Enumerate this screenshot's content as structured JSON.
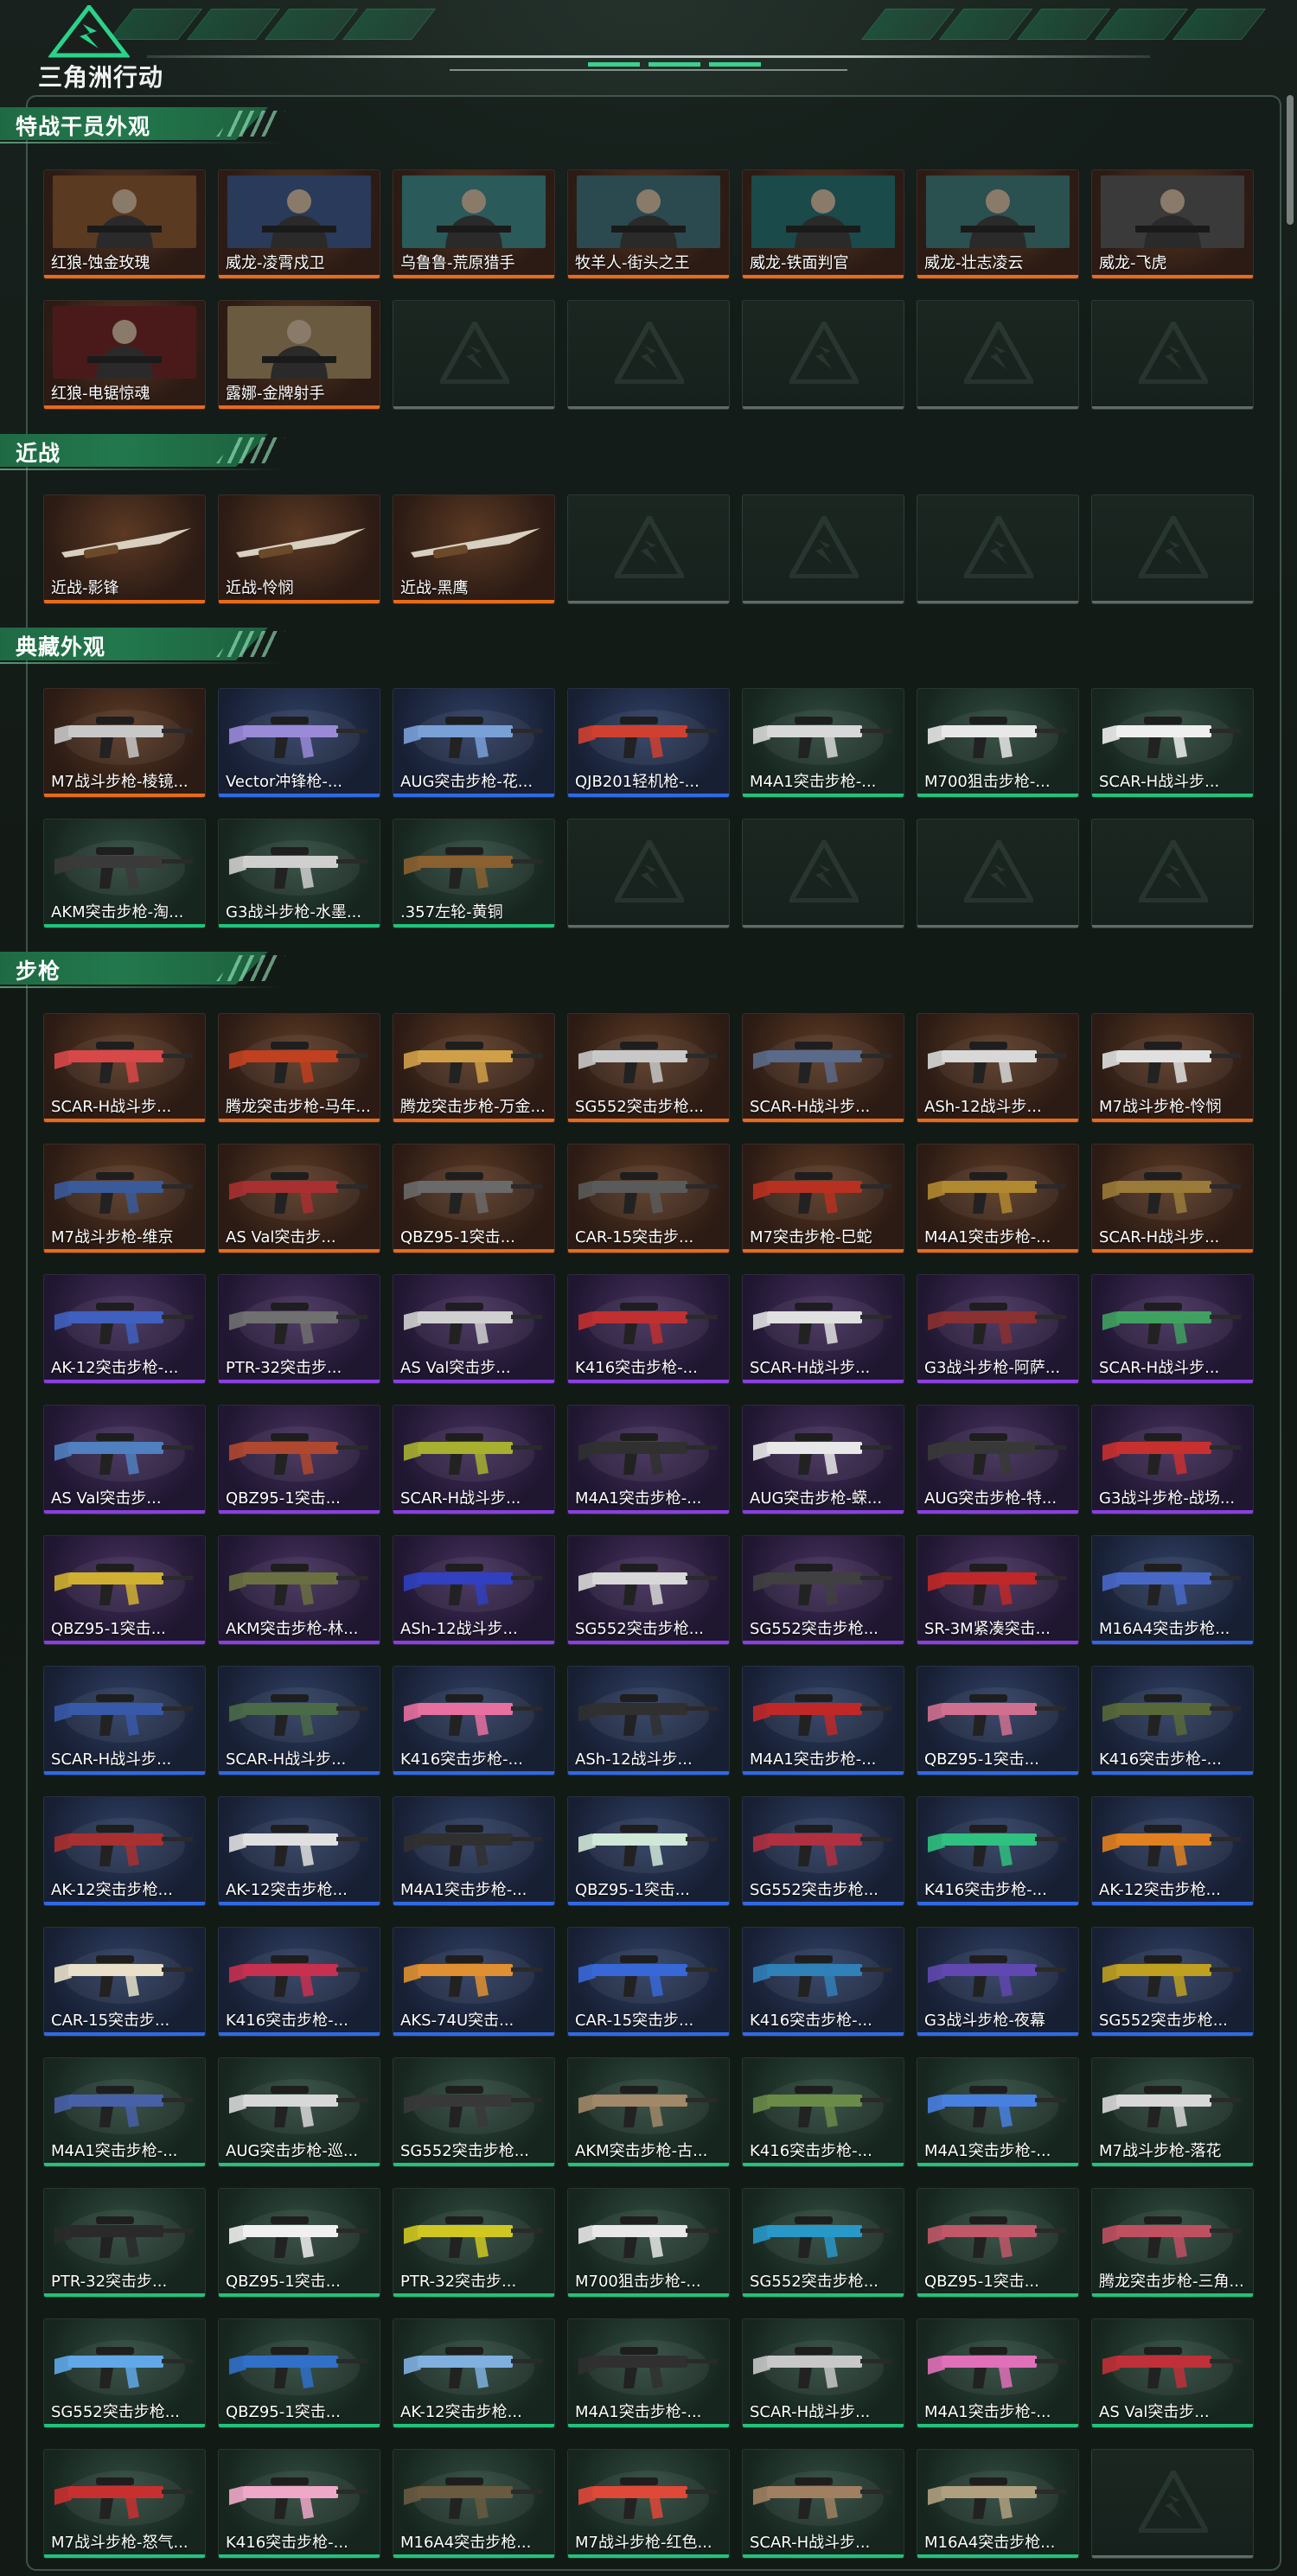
{
  "app": {
    "logo_text": "三角洲行动"
  },
  "colors": {
    "accent": "#22784c",
    "orange": "#e86a1a",
    "blue": "#2f69e6",
    "purple": "#8a3fe0",
    "green": "#22c27a"
  },
  "sections": [
    {
      "title": "特战干员外观",
      "items": [
        {
          "name": "红狼-蚀金玫瑰",
          "rarity": "orange",
          "kind": "operator"
        },
        {
          "name": "威龙-凌霄戍卫",
          "rarity": "orange",
          "kind": "operator"
        },
        {
          "name": "乌鲁鲁-荒原猎手",
          "rarity": "orange",
          "kind": "operator"
        },
        {
          "name": "牧羊人-街头之王",
          "rarity": "orange",
          "kind": "operator"
        },
        {
          "name": "威龙-铁面判官",
          "rarity": "orange",
          "kind": "operator"
        },
        {
          "name": "威龙-壮志凌云",
          "rarity": "orange",
          "kind": "operator"
        },
        {
          "name": "威龙-飞虎",
          "rarity": "orange",
          "kind": "operator"
        },
        {
          "name": "红狼-电锯惊魂",
          "rarity": "orange",
          "kind": "operator"
        },
        {
          "name": "露娜-金牌射手",
          "rarity": "orange",
          "kind": "operator"
        },
        {
          "empty": true
        },
        {
          "empty": true
        },
        {
          "empty": true
        },
        {
          "empty": true
        },
        {
          "empty": true
        }
      ]
    },
    {
      "title": "近战",
      "items": [
        {
          "name": "近战-影锋",
          "rarity": "orange",
          "kind": "melee"
        },
        {
          "name": "近战-怜悯",
          "rarity": "orange",
          "kind": "melee"
        },
        {
          "name": "近战-黑鹰",
          "rarity": "orange",
          "kind": "melee"
        },
        {
          "empty": true
        },
        {
          "empty": true
        },
        {
          "empty": true
        },
        {
          "empty": true
        }
      ]
    },
    {
      "title": "典藏外观",
      "items": [
        {
          "name": "M7战斗步枪-棱镜...",
          "rarity": "orange",
          "kind": "gun",
          "tint": "#c8c8c8"
        },
        {
          "name": "Vector冲锋枪-...",
          "rarity": "blue",
          "kind": "gun",
          "tint": "#9a8ad8"
        },
        {
          "name": "AUG突击步枪-花...",
          "rarity": "blue",
          "kind": "gun",
          "tint": "#7aa0d8"
        },
        {
          "name": "QJB201轻机枪-...",
          "rarity": "blue",
          "kind": "gun",
          "tint": "#d04030"
        },
        {
          "name": "M4A1突击步枪-...",
          "rarity": "green",
          "kind": "gun",
          "tint": "#d8d8d8"
        },
        {
          "name": "M700狙击步枪-...",
          "rarity": "green",
          "kind": "gun",
          "tint": "#e8e8e8"
        },
        {
          "name": "SCAR-H战斗步...",
          "rarity": "green",
          "kind": "gun",
          "tint": "#efefef"
        },
        {
          "name": "AKM突击步枪-淘...",
          "rarity": "green",
          "kind": "gun",
          "tint": "#3a3a3a"
        },
        {
          "name": "G3战斗步枪-水墨...",
          "rarity": "green",
          "kind": "gun",
          "tint": "#cfcfcf"
        },
        {
          "name": ".357左轮-黄铜",
          "rarity": "green",
          "kind": "gun",
          "tint": "#8a6030"
        },
        {
          "empty": true
        },
        {
          "empty": true
        },
        {
          "empty": true
        },
        {
          "empty": true
        }
      ]
    },
    {
      "title": "步枪",
      "items": [
        {
          "name": "SCAR-H战斗步...",
          "rarity": "orange",
          "kind": "gun",
          "tint": "#d84848"
        },
        {
          "name": "腾龙突击步枪-马年...",
          "rarity": "orange",
          "kind": "gun",
          "tint": "#c04020"
        },
        {
          "name": "腾龙突击步枪-万金...",
          "rarity": "orange",
          "kind": "gun",
          "tint": "#d0a048"
        },
        {
          "name": "SG552突击步枪...",
          "rarity": "orange",
          "kind": "gun",
          "tint": "#c8c8c8"
        },
        {
          "name": "SCAR-H战斗步...",
          "rarity": "orange",
          "kind": "gun",
          "tint": "#5a6a8a"
        },
        {
          "name": "ASh-12战斗步...",
          "rarity": "orange",
          "kind": "gun",
          "tint": "#d8d8d8"
        },
        {
          "name": "M7战斗步枪-怜悯",
          "rarity": "orange",
          "kind": "gun",
          "tint": "#e0e0e0"
        },
        {
          "name": "M7战斗步枪-维京",
          "rarity": "orange",
          "kind": "gun",
          "tint": "#3a5a9a"
        },
        {
          "name": "AS Val突击步...",
          "rarity": "orange",
          "kind": "gun",
          "tint": "#a83030"
        },
        {
          "name": "QBZ95-1突击...",
          "rarity": "orange",
          "kind": "gun",
          "tint": "#6a6a6a"
        },
        {
          "name": "CAR-15突击步...",
          "rarity": "orange",
          "kind": "gun",
          "tint": "#5a5a5a"
        },
        {
          "name": "M7突击步枪-巳蛇",
          "rarity": "orange",
          "kind": "gun",
          "tint": "#b83020"
        },
        {
          "name": "M4A1突击步枪-...",
          "rarity": "orange",
          "kind": "gun",
          "tint": "#b08830"
        },
        {
          "name": "SCAR-H战斗步...",
          "rarity": "orange",
          "kind": "gun",
          "tint": "#9a7a38"
        },
        {
          "name": "AK-12突击步枪-...",
          "rarity": "purple",
          "kind": "gun",
          "tint": "#4060c0"
        },
        {
          "name": "PTR-32突击步...",
          "rarity": "purple",
          "kind": "gun",
          "tint": "#707070"
        },
        {
          "name": "AS Val突击步...",
          "rarity": "purple",
          "kind": "gun",
          "tint": "#d0d0d0"
        },
        {
          "name": "K416突击步枪-...",
          "rarity": "purple",
          "kind": "gun",
          "tint": "#c03030"
        },
        {
          "name": "SCAR-H战斗步...",
          "rarity": "purple",
          "kind": "gun",
          "tint": "#e0e0e0"
        },
        {
          "name": "G3战斗步枪-阿萨...",
          "rarity": "purple",
          "kind": "gun",
          "tint": "#8a3030"
        },
        {
          "name": "SCAR-H战斗步...",
          "rarity": "purple",
          "kind": "gun",
          "tint": "#40a060"
        },
        {
          "name": "AS Val突击步...",
          "rarity": "purple",
          "kind": "gun",
          "tint": "#5080c0"
        },
        {
          "name": "QBZ95-1突击...",
          "rarity": "purple",
          "kind": "gun",
          "tint": "#b04830"
        },
        {
          "name": "SCAR-H战斗步...",
          "rarity": "purple",
          "kind": "gun",
          "tint": "#a8b030"
        },
        {
          "name": "M4A1突击步枪-...",
          "rarity": "purple",
          "kind": "gun",
          "tint": "#303030"
        },
        {
          "name": "AUG突击步枪-蝾...",
          "rarity": "purple",
          "kind": "gun",
          "tint": "#e8e8e8"
        },
        {
          "name": "AUG突击步枪-特...",
          "rarity": "purple",
          "kind": "gun",
          "tint": "#383838"
        },
        {
          "name": "G3战斗步枪-战场...",
          "rarity": "purple",
          "kind": "gun",
          "tint": "#c83030"
        },
        {
          "name": "QBZ95-1突击...",
          "rarity": "purple",
          "kind": "gun",
          "tint": "#d0b030"
        },
        {
          "name": "AKM突击步枪-林...",
          "rarity": "purple",
          "kind": "gun",
          "tint": "#6a7040"
        },
        {
          "name": "ASh-12战斗步...",
          "rarity": "purple",
          "kind": "gun",
          "tint": "#3040c0"
        },
        {
          "name": "SG552突击步枪...",
          "rarity": "purple",
          "kind": "gun",
          "tint": "#d8d8d8"
        },
        {
          "name": "SG552突击步枪...",
          "rarity": "purple",
          "kind": "gun",
          "tint": "#404040"
        },
        {
          "name": "SR-3M紧凑突击...",
          "rarity": "purple",
          "kind": "gun",
          "tint": "#c02828"
        },
        {
          "name": "M16A4突击步枪...",
          "rarity": "blue",
          "kind": "gun",
          "tint": "#4868c8"
        },
        {
          "name": "SCAR-H战斗步...",
          "rarity": "blue",
          "kind": "gun",
          "tint": "#3858a8"
        },
        {
          "name": "SCAR-H战斗步...",
          "rarity": "blue",
          "kind": "gun",
          "tint": "#4a6a48"
        },
        {
          "name": "K416突击步枪-...",
          "rarity": "blue",
          "kind": "gun",
          "tint": "#e870a0"
        },
        {
          "name": "ASh-12战斗步...",
          "rarity": "blue",
          "kind": "gun",
          "tint": "#303030"
        },
        {
          "name": "M4A1突击步枪-...",
          "rarity": "blue",
          "kind": "gun",
          "tint": "#c02828"
        },
        {
          "name": "QBZ95-1突击...",
          "rarity": "blue",
          "kind": "gun",
          "tint": "#d07090"
        },
        {
          "name": "K416突击步枪-...",
          "rarity": "blue",
          "kind": "gun",
          "tint": "#586838"
        },
        {
          "name": "AK-12突击步枪...",
          "rarity": "blue",
          "kind": "gun",
          "tint": "#a83030"
        },
        {
          "name": "AK-12突击步枪...",
          "rarity": "blue",
          "kind": "gun",
          "tint": "#e0e0e0"
        },
        {
          "name": "M4A1突击步枪-...",
          "rarity": "blue",
          "kind": "gun",
          "tint": "#303030"
        },
        {
          "name": "QBZ95-1突击...",
          "rarity": "blue",
          "kind": "gun",
          "tint": "#d0e8d8"
        },
        {
          "name": "SG552突击步枪...",
          "rarity": "blue",
          "kind": "gun",
          "tint": "#b03040"
        },
        {
          "name": "K416突击步枪-...",
          "rarity": "blue",
          "kind": "gun",
          "tint": "#30c080"
        },
        {
          "name": "AK-12突击步枪...",
          "rarity": "blue",
          "kind": "gun",
          "tint": "#e08020"
        },
        {
          "name": "CAR-15突击步...",
          "rarity": "blue",
          "kind": "gun",
          "tint": "#e8e0c8"
        },
        {
          "name": "K416突击步枪-...",
          "rarity": "blue",
          "kind": "gun",
          "tint": "#c83050"
        },
        {
          "name": "AKS-74U突击...",
          "rarity": "blue",
          "kind": "gun",
          "tint": "#e09030"
        },
        {
          "name": "CAR-15突击步...",
          "rarity": "blue",
          "kind": "gun",
          "tint": "#3868d8"
        },
        {
          "name": "K416突击步枪-...",
          "rarity": "blue",
          "kind": "gun",
          "tint": "#3080b8"
        },
        {
          "name": "G3战斗步枪-夜幕",
          "rarity": "blue",
          "kind": "gun",
          "tint": "#6048b0"
        },
        {
          "name": "SG552突击步枪...",
          "rarity": "blue",
          "kind": "gun",
          "tint": "#c0a020"
        },
        {
          "name": "M4A1突击步枪-...",
          "rarity": "green",
          "kind": "gun",
          "tint": "#4860a8"
        },
        {
          "name": "AUG突击步枪-巡...",
          "rarity": "green",
          "kind": "gun",
          "tint": "#d8d8d8"
        },
        {
          "name": "SG552突击步枪...",
          "rarity": "green",
          "kind": "gun",
          "tint": "#383838"
        },
        {
          "name": "AKM突击步枪-古...",
          "rarity": "green",
          "kind": "gun",
          "tint": "#a08868"
        },
        {
          "name": "K416突击步枪-...",
          "rarity": "green",
          "kind": "gun",
          "tint": "#6a8a48"
        },
        {
          "name": "M4A1突击步枪-...",
          "rarity": "green",
          "kind": "gun",
          "tint": "#4880e0"
        },
        {
          "name": "M7战斗步枪-落花",
          "rarity": "green",
          "kind": "gun",
          "tint": "#d8d8d8"
        },
        {
          "name": "PTR-32突击步...",
          "rarity": "green",
          "kind": "gun",
          "tint": "#2a2a2a"
        },
        {
          "name": "QBZ95-1突击...",
          "rarity": "green",
          "kind": "gun",
          "tint": "#f0f0f0"
        },
        {
          "name": "PTR-32突击步...",
          "rarity": "green",
          "kind": "gun",
          "tint": "#d0c820"
        },
        {
          "name": "M700狙击步枪-...",
          "rarity": "green",
          "kind": "gun",
          "tint": "#e8e8e8"
        },
        {
          "name": "SG552突击步枪...",
          "rarity": "green",
          "kind": "gun",
          "tint": "#2898c8"
        },
        {
          "name": "QBZ95-1突击...",
          "rarity": "green",
          "kind": "gun",
          "tint": "#c05868"
        },
        {
          "name": "腾龙突击步枪-三角...",
          "rarity": "green",
          "kind": "gun",
          "tint": "#c05060"
        },
        {
          "name": "SG552突击步枪...",
          "rarity": "green",
          "kind": "gun",
          "tint": "#60a8e8"
        },
        {
          "name": "QBZ95-1突击...",
          "rarity": "green",
          "kind": "gun",
          "tint": "#3070c8"
        },
        {
          "name": "AK-12突击步枪...",
          "rarity": "green",
          "kind": "gun",
          "tint": "#80b0e0"
        },
        {
          "name": "M4A1突击步枪-...",
          "rarity": "green",
          "kind": "gun",
          "tint": "#303030"
        },
        {
          "name": "SCAR-H战斗步...",
          "rarity": "green",
          "kind": "gun",
          "tint": "#c8c8c8"
        },
        {
          "name": "M4A1突击步枪-...",
          "rarity": "green",
          "kind": "gun",
          "tint": "#e070b8"
        },
        {
          "name": "AS Val突击步...",
          "rarity": "green",
          "kind": "gun",
          "tint": "#c03038"
        },
        {
          "name": "M7战斗步枪-怒气...",
          "rarity": "green",
          "kind": "gun",
          "tint": "#c83030"
        },
        {
          "name": "K416突击步枪-...",
          "rarity": "green",
          "kind": "gun",
          "tint": "#f0a8c8"
        },
        {
          "name": "M16A4突击步枪...",
          "rarity": "green",
          "kind": "gun",
          "tint": "#6a5a40"
        },
        {
          "name": "M7战斗步枪-红色...",
          "rarity": "green",
          "kind": "gun",
          "tint": "#e04838"
        },
        {
          "name": "SCAR-H战斗步...",
          "rarity": "green",
          "kind": "gun",
          "tint": "#a08060"
        },
        {
          "name": "M16A4突击步枪...",
          "rarity": "green",
          "kind": "gun",
          "tint": "#b0a080"
        },
        {
          "empty": true
        }
      ]
    }
  ]
}
